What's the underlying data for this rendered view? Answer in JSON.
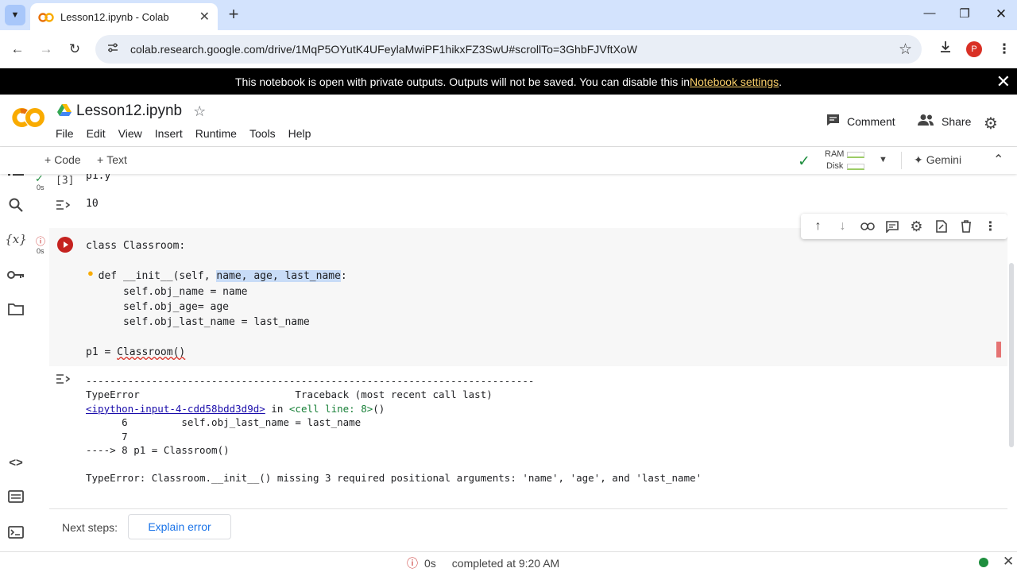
{
  "browser": {
    "tab_title": "Lesson12.ipynb - Colab",
    "url": "colab.research.google.com/drive/1MqP5OYutK4UFeylaMwiPF1hikxFZ3SwU#scrollTo=3GhbFJVftXoW",
    "profile_initial": "P"
  },
  "banner": {
    "text": "This notebook is open with private outputs. Outputs will not be saved. You can disable this in ",
    "link": "Notebook settings",
    "suffix": "."
  },
  "colab": {
    "logo": "CO",
    "filename": "Lesson12.ipynb",
    "menu": [
      "File",
      "Edit",
      "View",
      "Insert",
      "Runtime",
      "Tools",
      "Help"
    ],
    "comment_label": "Comment",
    "share_label": "Share"
  },
  "toolbar": {
    "add_code": "Code",
    "add_text": "Text",
    "ram_label": "RAM",
    "disk_label": "Disk",
    "gemini_label": "Gemini"
  },
  "cell1": {
    "prompt": "[3]",
    "exec_time": "0s",
    "source": "p1.y",
    "output": "10"
  },
  "cell2": {
    "exec_time": "0s",
    "line1": "class Classroom:",
    "line3_pre": "  def __init__(self, ",
    "line3_sel": "name, age, last_name",
    "line3_post": ":",
    "line4": "      self.obj_name = name",
    "line5": "      self.obj_age= age",
    "line6": "      self.obj_last_name = last_name",
    "line8_pre": "p1 = ",
    "line8_err": "Classroom()"
  },
  "traceback": {
    "rule": "---------------------------------------------------------------------------",
    "err_type": "TypeError",
    "header_right": "Traceback (most recent call last)",
    "link": "<ipython-input-4-cdd58bdd3d9d>",
    "in_text": " in ",
    "cell_ref": "<cell line: 8>",
    "cell_ref_suffix": "()",
    "line6": "      6         self.obj_last_name = last_name",
    "line7": "      7",
    "line8": "----> 8 p1 = Classroom()",
    "message": "TypeError: Classroom.__init__() missing 3 required positional arguments: 'name', 'age', and 'last_name'"
  },
  "next_steps": {
    "label": "Next steps:",
    "button": "Explain error"
  },
  "status": {
    "time": "0s",
    "text": "completed at 9:20 AM"
  },
  "colors": {
    "tabbar": "#d3e3fd",
    "banner_link": "#fcd06a",
    "run_error": "#c5221f",
    "selection": "#c8dcf7",
    "status_ok": "#1e8e3e"
  }
}
